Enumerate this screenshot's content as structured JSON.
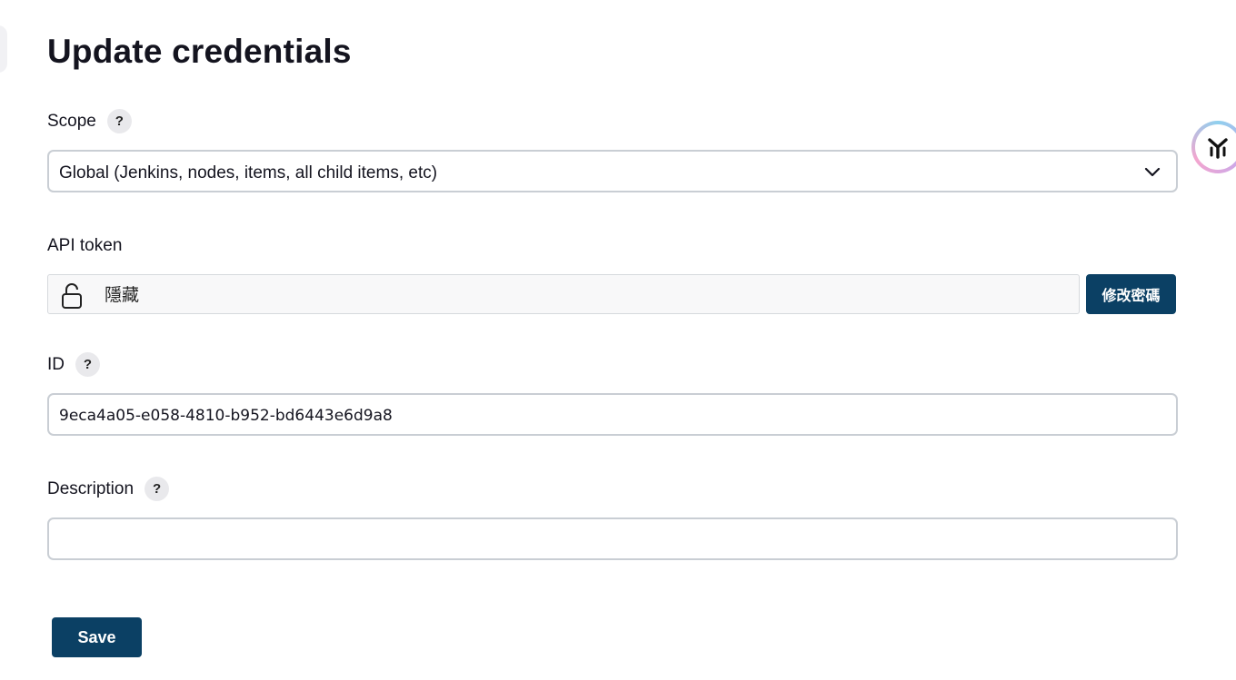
{
  "page": {
    "title": "Update credentials"
  },
  "scope": {
    "label": "Scope",
    "help": "?",
    "selected": "Global (Jenkins, nodes, items, all child items, etc)"
  },
  "api_token": {
    "label": "API token",
    "value": "隱藏",
    "change_button": "修改密碼"
  },
  "id_field": {
    "label": "ID",
    "help": "?",
    "value": "9eca4a05-e058-4810-b952-bd6443e6d9a8"
  },
  "description": {
    "label": "Description",
    "help": "?",
    "value": ""
  },
  "actions": {
    "save_label": "Save"
  },
  "icons": {
    "scope_dropdown": "chevron-down-icon",
    "secret": "lock-icon",
    "assistant": "assistant-badge-icon"
  },
  "colors": {
    "primary_button": "#0b4064",
    "field_border": "#c9ced4",
    "help_bg": "#e9e9ec"
  }
}
